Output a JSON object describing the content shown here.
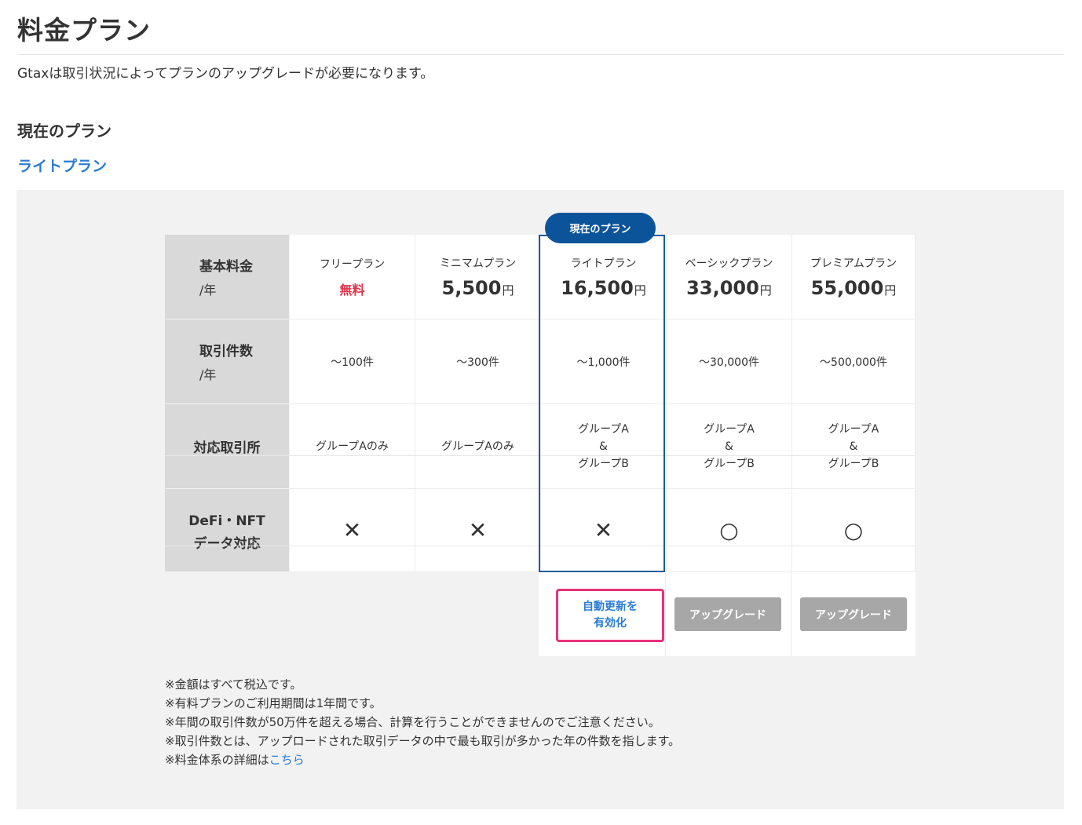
{
  "page": {
    "title": "料金プラン",
    "description": "Gtaxは取引状況によってプランのアップグレードが必要になります。",
    "section_heading": "現在のプラン",
    "current_plan_name": "ライトプラン"
  },
  "table": {
    "current_badge": "現在のプラン",
    "row_headers": [
      {
        "main": "基本料金",
        "sub": "/年"
      },
      {
        "main": "取引件数",
        "sub": "/年"
      },
      {
        "main": "対応取引所",
        "sub": ""
      },
      {
        "main": "DeFi・NFT",
        "sub": "データ対応"
      }
    ],
    "plans": [
      {
        "name": "フリープラン",
        "price": "無料",
        "price_unit": "",
        "count": "〜100件",
        "exchange": [
          "グループAのみ"
        ],
        "defi": "✕"
      },
      {
        "name": "ミニマムプラン",
        "price": "5,500",
        "price_unit": "円",
        "count": "〜300件",
        "exchange": [
          "グループAのみ"
        ],
        "defi": "✕"
      },
      {
        "name": "ライトプラン",
        "price": "16,500",
        "price_unit": "円",
        "count": "〜1,000件",
        "exchange": [
          "グループA",
          "&",
          "グループB"
        ],
        "defi": "✕"
      },
      {
        "name": "ベーシックプラン",
        "price": "33,000",
        "price_unit": "円",
        "count": "〜30,000件",
        "exchange": [
          "グループA",
          "&",
          "グループB"
        ],
        "defi": "○"
      },
      {
        "name": "プレミアムプラン",
        "price": "55,000",
        "price_unit": "円",
        "count": "〜500,000件",
        "exchange": [
          "グループA",
          "&",
          "グループB"
        ],
        "defi": "○"
      }
    ],
    "buttons": {
      "autorenew_line1": "自動更新を",
      "autorenew_line2": "有効化",
      "upgrade": "アップグレード"
    }
  },
  "notes": [
    "※金額はすべて税込です。",
    "※有料プランのご利用期間は1年間です。",
    "※年間の取引件数が50万件を超える場合、計算を行うことができませんのでご注意ください。",
    "※取引件数とは、アップロードされた取引データの中で最も取引が多かった年の件数を指します。"
  ],
  "notes_link": {
    "prefix": "※料金体系の詳細は",
    "link": "こちら"
  },
  "colors": {
    "accent_blue": "#0c5499",
    "link_blue": "#2b7cd3",
    "highlight_pink": "#e8327a",
    "free_red": "#e0334c",
    "upgrade_gray": "#a7a7a7"
  }
}
